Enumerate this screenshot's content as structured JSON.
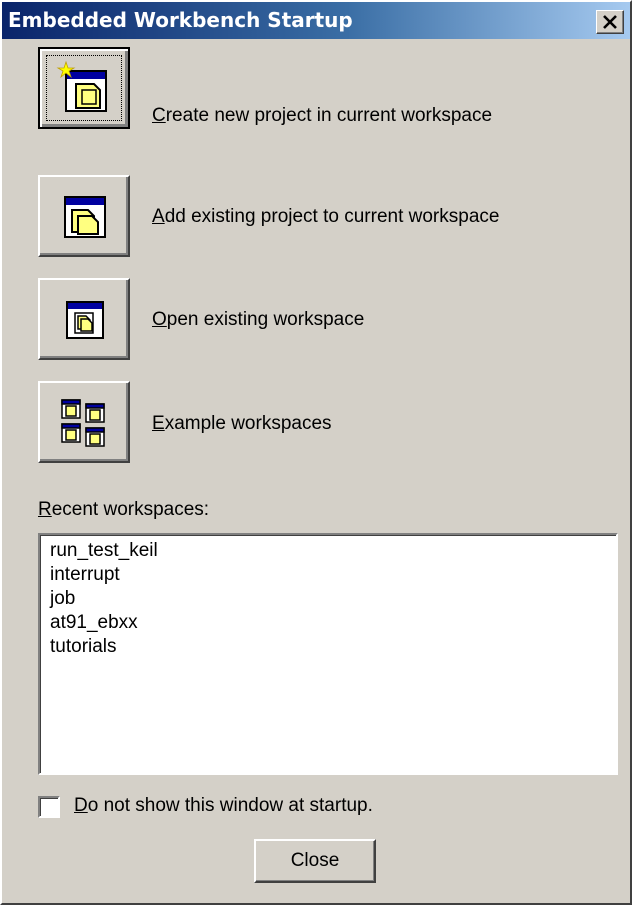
{
  "window": {
    "title": "Embedded Workbench Startup",
    "close_glyph": "X"
  },
  "actions": [
    {
      "mnemonic": "C",
      "rest": "reate new project in current workspace",
      "icon": "new-project-icon"
    },
    {
      "mnemonic": "A",
      "rest": "dd existing project to current workspace",
      "icon": "add-project-icon"
    },
    {
      "mnemonic": "O",
      "rest": "pen existing workspace",
      "icon": "open-workspace-icon"
    },
    {
      "mnemonic": "E",
      "rest": "xample workspaces",
      "icon": "example-workspaces-icon"
    }
  ],
  "recent": {
    "label_mnemonic": "R",
    "label_rest": "ecent workspaces:",
    "items": [
      "run_test_keil",
      "interrupt",
      "job",
      "at91_ebxx",
      "tutorials"
    ]
  },
  "startup_checkbox": {
    "checked": false,
    "label_mnemonic": "D",
    "label_rest": "o not show this window at startup."
  },
  "close_button": {
    "label": "Close"
  },
  "colors": {
    "face": "#d4d0c8",
    "title_start": "#0a246a",
    "title_end": "#a6caf0",
    "icon_yellow": "#ffff80",
    "icon_blue": "#0000a0"
  }
}
